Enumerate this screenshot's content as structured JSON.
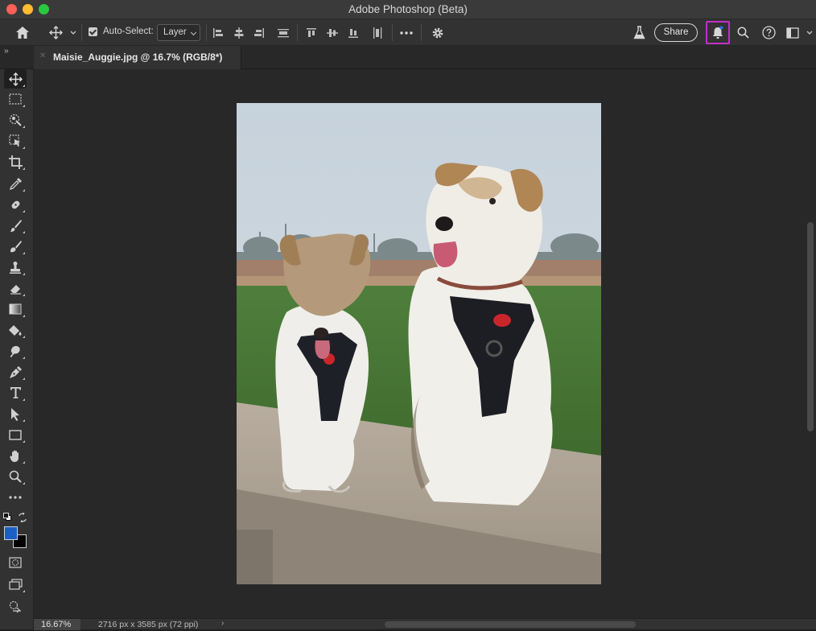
{
  "window": {
    "title": "Adobe Photoshop (Beta)"
  },
  "options_bar": {
    "auto_select_label": "Auto-Select:",
    "auto_select_checked": true,
    "layer_select_value": "Layer",
    "share_label": "Share",
    "icons": [
      "home-icon",
      "move-tool-icon",
      "align-left-icon",
      "align-center-icon",
      "align-right-icon",
      "distribute-icon",
      "align-top-icon",
      "align-middle-icon",
      "align-bottom-icon",
      "distribute-vertical-icon",
      "more-icon",
      "gear-icon",
      "beaker-icon",
      "bell-icon",
      "search-icon",
      "help-icon",
      "workspace-icon"
    ]
  },
  "document_tab": {
    "name": "Maisie_Auggie.jpg @ 16.7% (RGB/8*)"
  },
  "toolbar": {
    "tools": [
      "move",
      "marquee",
      "quick-select",
      "object-select",
      "crop",
      "eyedropper",
      "healing-brush",
      "brush",
      "clone-stamp",
      "eraser",
      "gradient",
      "paint-bucket",
      "dodge",
      "pen",
      "type",
      "path-select",
      "rectangle",
      "hand",
      "zoom",
      "more"
    ],
    "foreground_color": "#1c5fc4",
    "background_color": "#000000"
  },
  "status_bar": {
    "zoom": "16.67%",
    "doc_info": "2716 px x 3585 px (72 ppi)",
    "arrow": "›"
  },
  "colors": {
    "accent": "#c12fcb",
    "ui_bg": "#323232"
  }
}
